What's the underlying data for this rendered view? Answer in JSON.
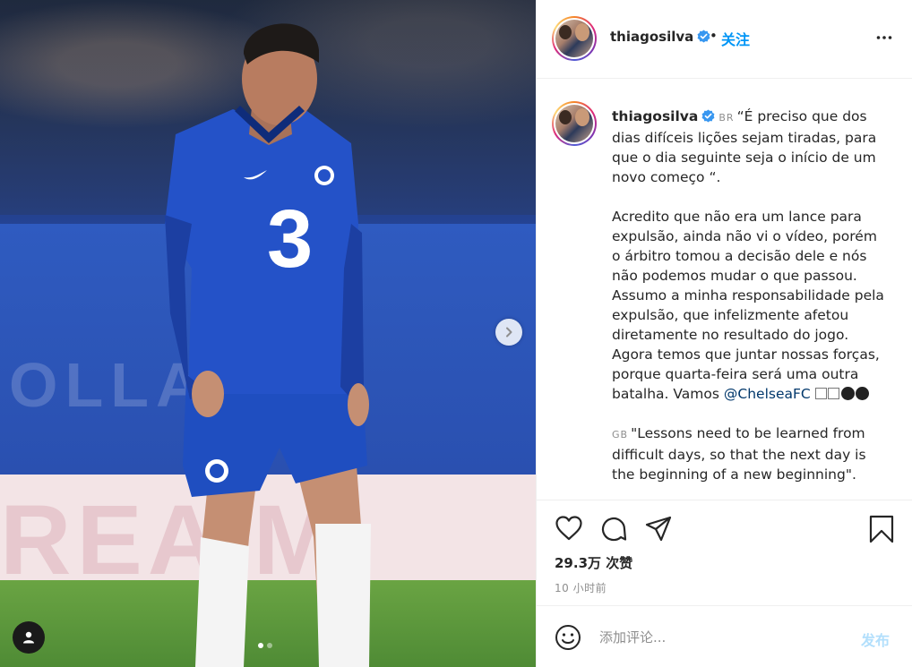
{
  "post": {
    "username": "thiagosilva",
    "follow_label": "关注",
    "separator": "•",
    "carousel": {
      "slide_count": 2,
      "active_index": 0
    },
    "photo_text": {
      "blue_board": "OLLA",
      "white_board": "REA   M"
    },
    "caption": {
      "username": "thiagosilva",
      "flag_br": "BR",
      "flag_gb": "GB",
      "para1": "“É preciso que dos dias difíceis lições sejam tiradas, para que o dia seguinte seja o início de um novo começo “.",
      "para2_before": "Acredito que não era um lance para expulsão, ainda não vi o vídeo, porém o árbitro tomou a decisão dele e nós não podemos mudar o que passou. Assumo a minha responsabilidade pela expulsão, que infelizmente afetou diretamente no resultado do jogo. Agora temos que juntar nossas forças, porque quarta-feira será uma outra batalha. Vamos ",
      "mention": "@ChelseaFC",
      "para3": "\"Lessons need to be learned from difficult days, so that the next day is the beginning of a new beginning\"."
    },
    "likes": "29.3万 次赞",
    "time_ago": "10 小时前",
    "comment": {
      "placeholder": "添加评论...",
      "post_label": "发布"
    }
  },
  "colors": {
    "accent": "#0095f6",
    "post_disabled": "#b2dffc",
    "text": "#262626",
    "muted": "#8e8e8e"
  },
  "icons": [
    "chevron-right-icon",
    "user-tag-icon",
    "verified-icon",
    "more-icon",
    "heart-icon",
    "comment-icon",
    "share-icon",
    "bookmark-icon",
    "smile-icon"
  ]
}
